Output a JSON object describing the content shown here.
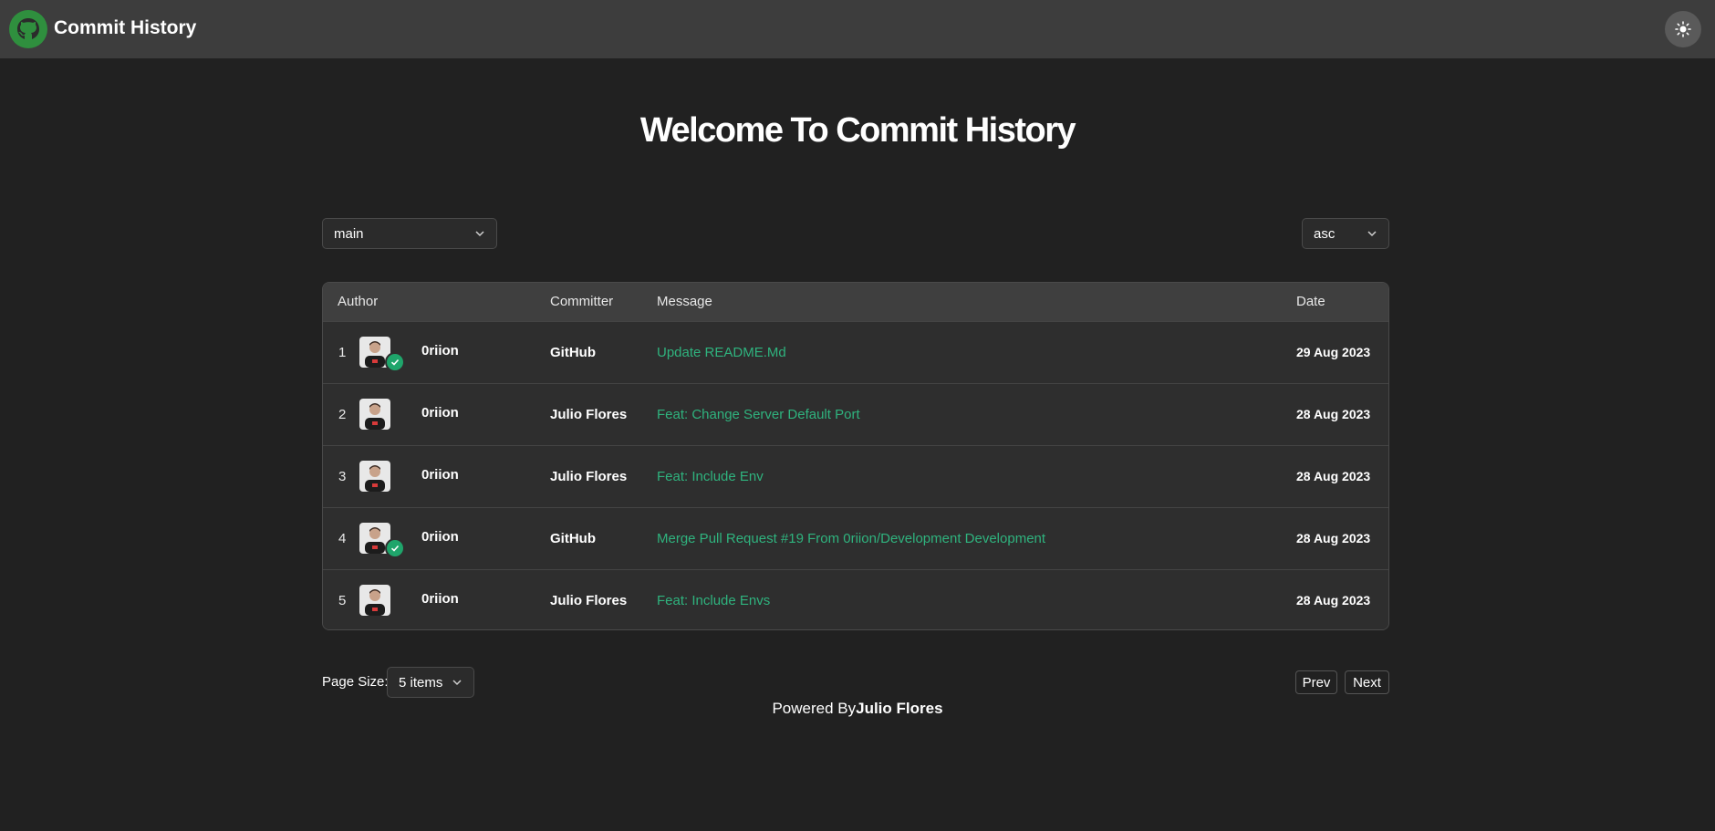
{
  "header": {
    "title": "Commit History",
    "logo_icon": "github-icon",
    "theme_icon": "sun-icon",
    "accent": "#2f8f3e"
  },
  "main": {
    "welcome": "Welcome To Commit History",
    "branch_select": {
      "value": "main"
    },
    "order_select": {
      "value": "asc"
    }
  },
  "table": {
    "columns": [
      "Author",
      "Committer",
      "Message",
      "Date"
    ],
    "rows": [
      {
        "num": "1",
        "author": "0riion",
        "committer": "GitHub",
        "message": "Update README.Md",
        "date": "29 Aug 2023",
        "verified": true
      },
      {
        "num": "2",
        "author": "0riion",
        "committer": "Julio Flores",
        "message": "Feat: Change Server Default Port",
        "date": "28 Aug 2023",
        "verified": false
      },
      {
        "num": "3",
        "author": "0riion",
        "committer": "Julio Flores",
        "message": "Feat: Include Env",
        "date": "28 Aug 2023",
        "verified": false
      },
      {
        "num": "4",
        "author": "0riion",
        "committer": "GitHub",
        "message": "Merge Pull Request #19 From 0riion/Development Development",
        "date": "28 Aug 2023",
        "verified": true
      },
      {
        "num": "5",
        "author": "0riion",
        "committer": "Julio Flores",
        "message": "Feat: Include Envs",
        "date": "28 Aug 2023",
        "verified": false
      }
    ],
    "message_color": "#2fb37e",
    "verified_color": "#1fa56b"
  },
  "pagination": {
    "page_size_label": "Page Size:",
    "page_size_value": "5 items",
    "prev_label": "Prev",
    "next_label": "Next"
  },
  "footer": {
    "prefix": "Powered By",
    "name": "Julio Flores"
  }
}
